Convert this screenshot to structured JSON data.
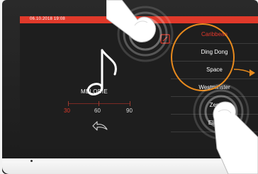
{
  "status": {
    "datetime": "06.10.2018  19:08"
  },
  "melody": {
    "label": "MÉLODIE",
    "icon": "music-note-icon"
  },
  "timeline": {
    "values": [
      "30",
      "60",
      "90"
    ],
    "selected": "30"
  },
  "back": {
    "icon": "back-arrow-icon"
  },
  "melody_list": {
    "items": [
      {
        "label": "Caribbean"
      },
      {
        "label": "Ding Dong"
      },
      {
        "label": "Space"
      },
      {
        "label": "Westminster"
      },
      {
        "label": "Zen"
      },
      {
        "label": "Elise"
      }
    ],
    "selected": "Caribbean"
  },
  "colors": {
    "accent": "#e0392a",
    "highlight": "#e88a1d",
    "screen_bg": "#1e1e1e"
  }
}
